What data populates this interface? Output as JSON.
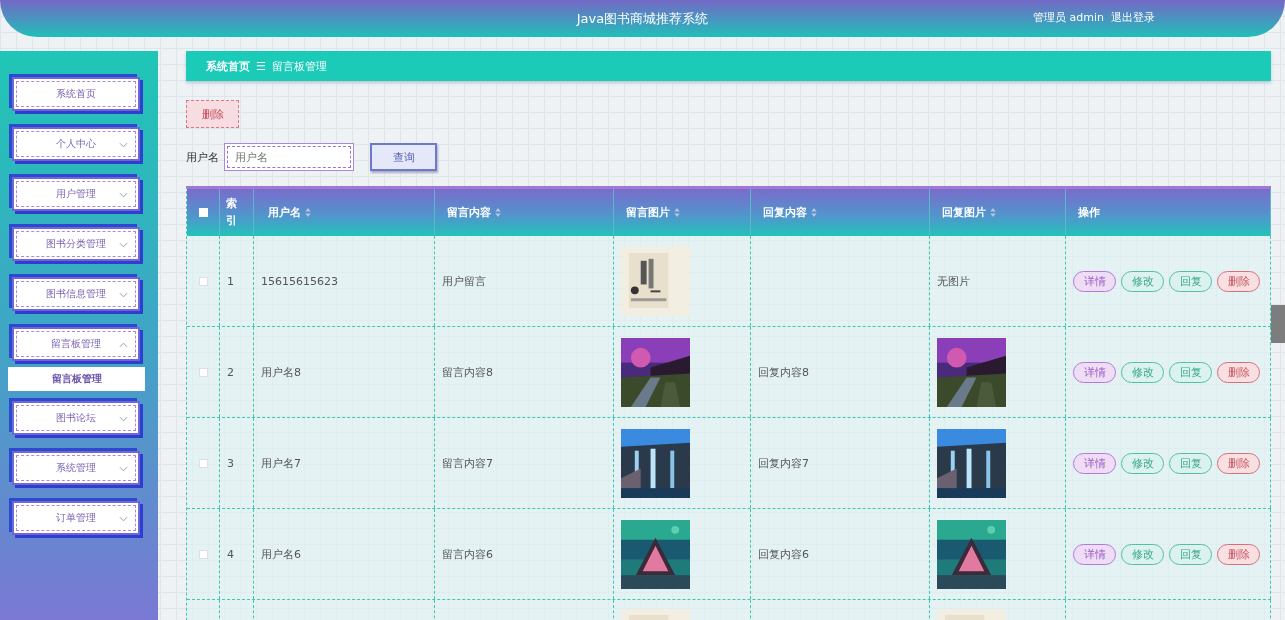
{
  "header": {
    "title": "Java图书商城推荐系统",
    "user": "管理员 admin",
    "logout": "退出登录"
  },
  "sidebar": {
    "items": [
      {
        "label": "系统首页"
      },
      {
        "label": "个人中心",
        "expanded": false
      },
      {
        "label": "用户管理",
        "expanded": false
      },
      {
        "label": "图书分类管理",
        "expanded": false
      },
      {
        "label": "图书信息管理",
        "expanded": false
      },
      {
        "label": "留言板管理",
        "expanded": true,
        "children": [
          {
            "label": "留言板管理",
            "selected": true
          }
        ]
      },
      {
        "label": "图书论坛",
        "expanded": false
      },
      {
        "label": "系统管理",
        "expanded": false
      },
      {
        "label": "订单管理",
        "expanded": false
      }
    ]
  },
  "breadcrumb": {
    "items": [
      "系统首页",
      "留言板管理"
    ],
    "separator": "☰"
  },
  "toolbar": {
    "delete": "删除",
    "search_label": "用户名",
    "search_placeholder": "用户名",
    "search_button": "查询"
  },
  "table": {
    "select_all_checked": false,
    "columns": [
      {
        "label": "索引",
        "sortable": false
      },
      {
        "label": "用户名",
        "sortable": true
      },
      {
        "label": "留言内容",
        "sortable": true
      },
      {
        "label": "留言图片",
        "sortable": true
      },
      {
        "label": "回复内容",
        "sortable": true
      },
      {
        "label": "回复图片",
        "sortable": true
      },
      {
        "label": "操作",
        "sortable": false
      }
    ],
    "rows": [
      {
        "checked": false,
        "index": "1",
        "user": "15615615623",
        "content": "用户留言",
        "image": {
          "kind": "picture"
        },
        "reply_image": {
          "kind": "text",
          "text": "无图片"
        },
        "actions": [
          {
            "label": "详情",
            "kind": "detail"
          },
          {
            "label": "修改",
            "kind": "edit"
          },
          {
            "label": "回复",
            "kind": "reply"
          },
          {
            "label": "删除",
            "kind": "delete"
          }
        ]
      },
      {
        "checked": false,
        "index": "2",
        "user": "用户名8",
        "content": "留言内容8",
        "image": {
          "kind": "picture"
        },
        "reply": "回复内容8",
        "reply_image": {
          "kind": "picture"
        },
        "actions": [
          {
            "label": "详情",
            "kind": "detail"
          },
          {
            "label": "修改",
            "kind": "edit"
          },
          {
            "label": "回复",
            "kind": "reply"
          },
          {
            "label": "删除",
            "kind": "delete"
          }
        ]
      },
      {
        "checked": false,
        "index": "3",
        "user": "用户名7",
        "content": "留言内容7",
        "image": {
          "kind": "picture"
        },
        "reply": "回复内容7",
        "reply_image": {
          "kind": "picture"
        },
        "actions": [
          {
            "label": "详情",
            "kind": "detail"
          },
          {
            "label": "修改",
            "kind": "edit"
          },
          {
            "label": "回复",
            "kind": "reply"
          },
          {
            "label": "删除",
            "kind": "delete"
          }
        ]
      },
      {
        "checked": false,
        "index": "4",
        "user": "用户名6",
        "content": "留言内容6",
        "image": {
          "kind": "picture"
        },
        "reply": "回复内容6",
        "reply_image": {
          "kind": "picture"
        },
        "actions": [
          {
            "label": "详情",
            "kind": "detail"
          },
          {
            "label": "修改",
            "kind": "edit"
          },
          {
            "label": "回复",
            "kind": "reply"
          },
          {
            "label": "删除",
            "kind": "delete"
          }
        ]
      },
      {
        "image": {
          "kind": "picture"
        },
        "reply_image": {
          "kind": "picture"
        }
      }
    ]
  }
}
